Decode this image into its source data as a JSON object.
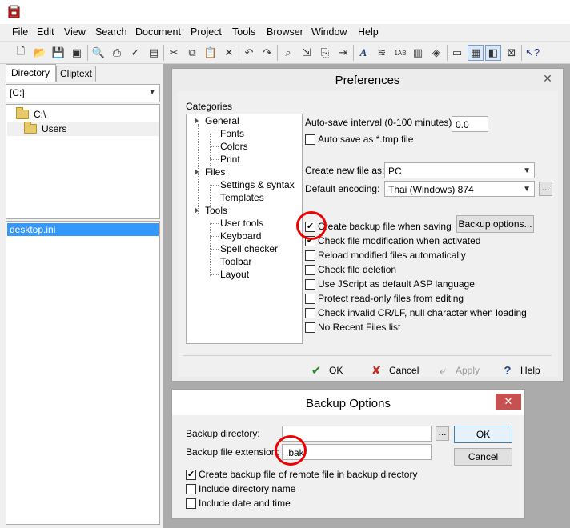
{
  "menu": [
    "File",
    "Edit",
    "View",
    "Search",
    "Document",
    "Project",
    "Tools",
    "Browser",
    "Window",
    "Help"
  ],
  "left_panel": {
    "tabs": [
      "Directory",
      "Cliptext"
    ],
    "drive": "[C:]",
    "tree": [
      "C:\\",
      "Users"
    ],
    "files": [
      "desktop.ini"
    ]
  },
  "preferences": {
    "title": "Preferences",
    "close": "✕",
    "categories_label": "Categories",
    "categories": {
      "general": "General",
      "fonts": "Fonts",
      "colors": "Colors",
      "print": "Print",
      "files": "Files",
      "settings_syntax": "Settings & syntax",
      "templates": "Templates",
      "tools": "Tools",
      "user_tools": "User tools",
      "keyboard": "Keyboard",
      "spell_checker": "Spell checker",
      "toolbar": "Toolbar",
      "layout": "Layout"
    },
    "autosave_label": "Auto-save interval (0-100 minutes):",
    "autosave_value": "0.0",
    "autosave_tmp": "Auto save as *.tmp file",
    "create_new_label": "Create new file as:",
    "create_new_value": "PC",
    "encoding_label": "Default encoding:",
    "encoding_value": "Thai (Windows) 874",
    "ellipsis": "...",
    "backup_options_button": "Backup options...",
    "options": [
      {
        "label": "Create backup file when saving",
        "checked": true
      },
      {
        "label": "Check file modification when activated",
        "checked": true
      },
      {
        "label": "Reload modified files automatically",
        "checked": false
      },
      {
        "label": "Check file deletion",
        "checked": false
      },
      {
        "label": "Use JScript as default ASP language",
        "checked": false
      },
      {
        "label": "Protect read-only files from editing",
        "checked": false
      },
      {
        "label": "Check invalid CR/LF, null character when loading",
        "checked": false
      },
      {
        "label": "No Recent Files list",
        "checked": false
      }
    ],
    "ok": "OK",
    "cancel": "Cancel",
    "apply": "Apply",
    "help": "Help"
  },
  "backup": {
    "title": "Backup Options",
    "close": "✕",
    "dir_label": "Backup directory:",
    "dir_value": "",
    "ext_label": "Backup file extension:",
    "ext_value": ".bak",
    "ellipsis": "...",
    "ok": "OK",
    "cancel": "Cancel",
    "options": [
      {
        "label": "Create backup file of remote file in backup directory",
        "checked": true
      },
      {
        "label": "Include directory name",
        "checked": false
      },
      {
        "label": "Include date and time",
        "checked": false
      }
    ]
  },
  "colors": {
    "highlight": "#3399ff",
    "annotation": "#e00000"
  }
}
